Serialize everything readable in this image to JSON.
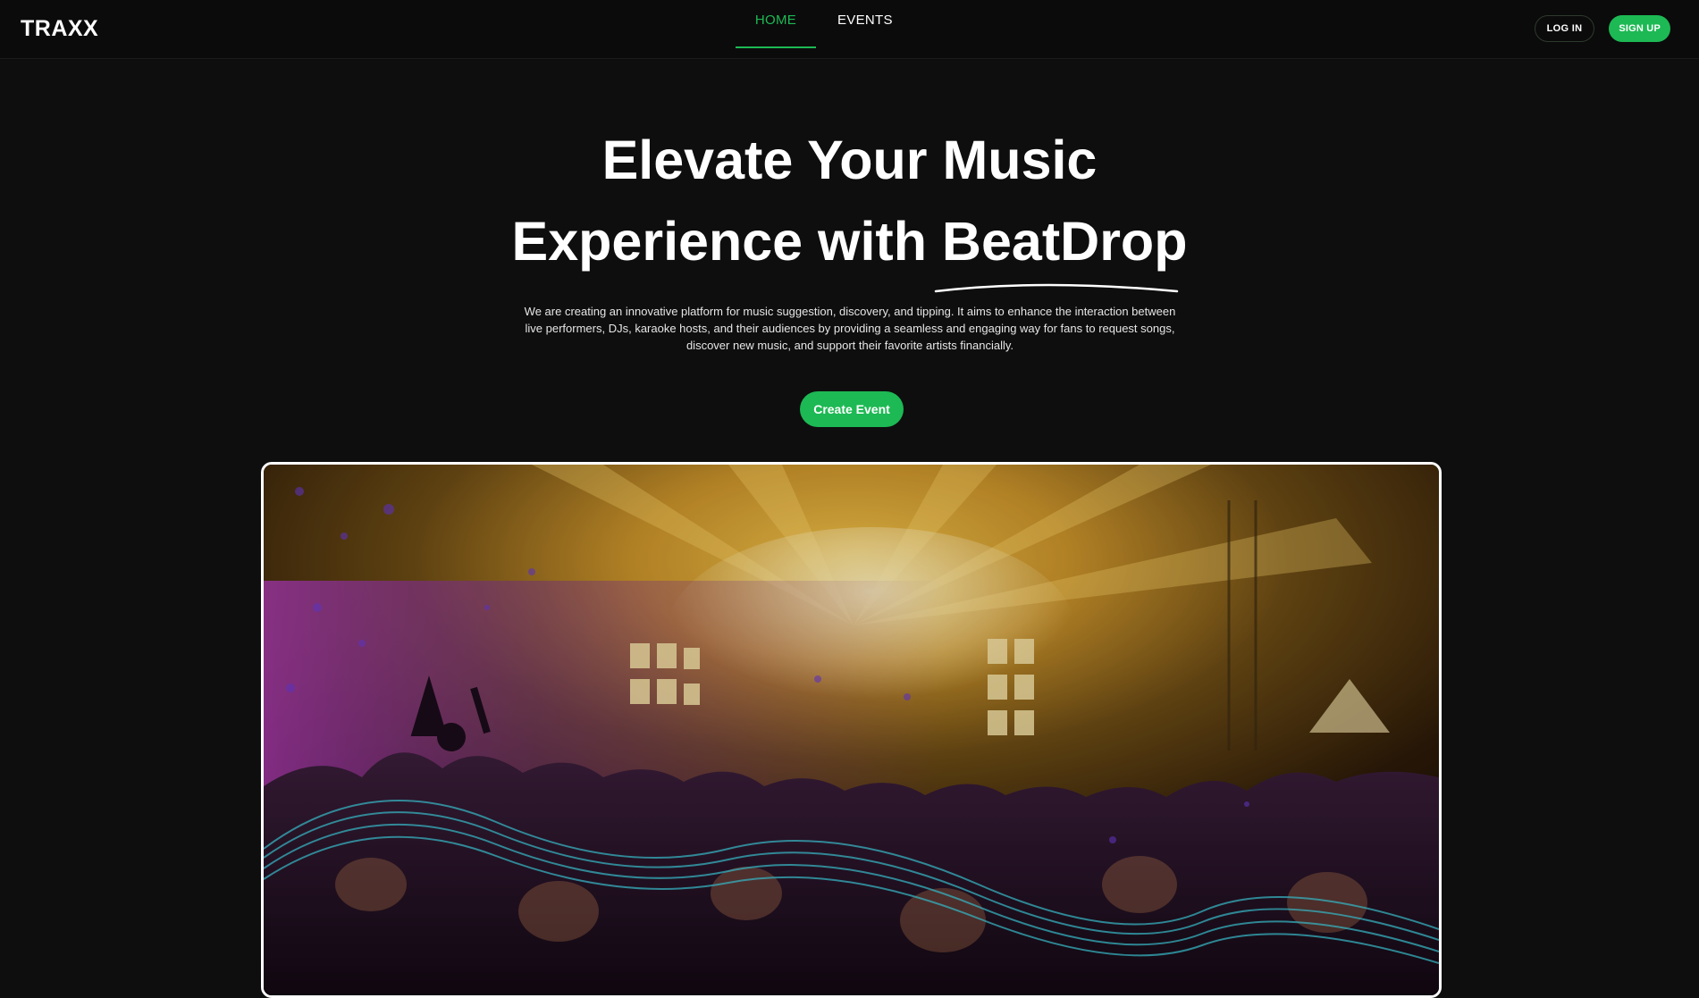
{
  "header": {
    "logo": "TRAXX",
    "tabs": [
      {
        "label": "HOME",
        "active": true
      },
      {
        "label": "EVENTS",
        "active": false
      }
    ],
    "login_label": "LOG IN",
    "signup_label": "SIGN UP"
  },
  "hero": {
    "title_line1": "Elevate Your Music",
    "title_line2_prefix": "Experience with ",
    "title_brand": "BeatDrop",
    "description": "We are creating an innovative platform for music suggestion, discovery, and tipping. It aims to enhance the interaction between live performers, DJs, karaoke hosts, and their audiences by providing a seamless and engaging way for fans to request songs, discover new music, and support their favorite artists financially.",
    "cta_label": "Create Event"
  },
  "image": {
    "subject": "concert-crowd-stage-lights"
  },
  "colors": {
    "accent": "#1db954",
    "background": "#0e0e0e"
  }
}
